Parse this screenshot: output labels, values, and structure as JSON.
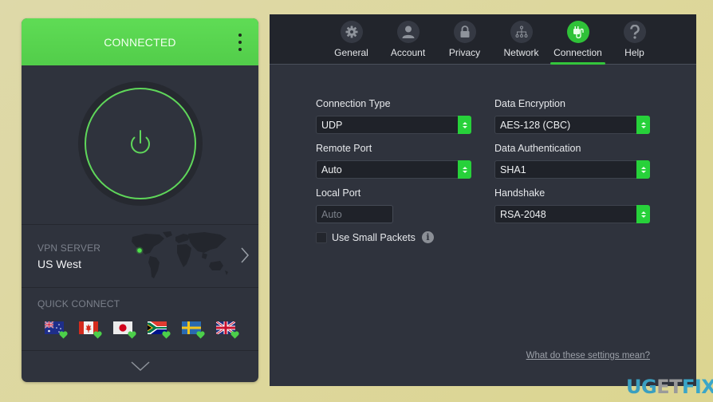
{
  "left_panel": {
    "status": "CONNECTED",
    "server": {
      "label": "VPN SERVER",
      "value": "US West"
    },
    "quick_connect": {
      "label": "QUICK CONNECT",
      "flags": [
        "Australia",
        "Canada",
        "Japan",
        "South Africa",
        "Sweden",
        "United Kingdom"
      ]
    }
  },
  "right_panel": {
    "tabs": [
      {
        "label": "General",
        "icon": "gear-icon"
      },
      {
        "label": "Account",
        "icon": "user-icon"
      },
      {
        "label": "Privacy",
        "icon": "lock-icon"
      },
      {
        "label": "Network",
        "icon": "network-icon"
      },
      {
        "label": "Connection",
        "icon": "plug-icon",
        "active": true
      },
      {
        "label": "Help",
        "icon": "help-icon"
      }
    ],
    "fields": {
      "connection_type": {
        "label": "Connection Type",
        "value": "UDP"
      },
      "remote_port": {
        "label": "Remote Port",
        "value": "Auto"
      },
      "local_port": {
        "label": "Local Port",
        "value": "",
        "placeholder": "Auto"
      },
      "use_small_packets": {
        "label": "Use Small Packets",
        "checked": false
      },
      "data_encryption": {
        "label": "Data Encryption",
        "value": "AES-128 (CBC)"
      },
      "data_authentication": {
        "label": "Data Authentication",
        "value": "SHA1"
      },
      "handshake": {
        "label": "Handshake",
        "value": "RSA-2048"
      }
    },
    "help_link": "What do these settings mean?"
  },
  "watermark": {
    "part1": "UG",
    "part2": "ET",
    "part3": "FIX"
  },
  "colors": {
    "accent_green": "#2fc238",
    "header_green": "#5fdc55",
    "panel_bg": "#2f333d"
  }
}
